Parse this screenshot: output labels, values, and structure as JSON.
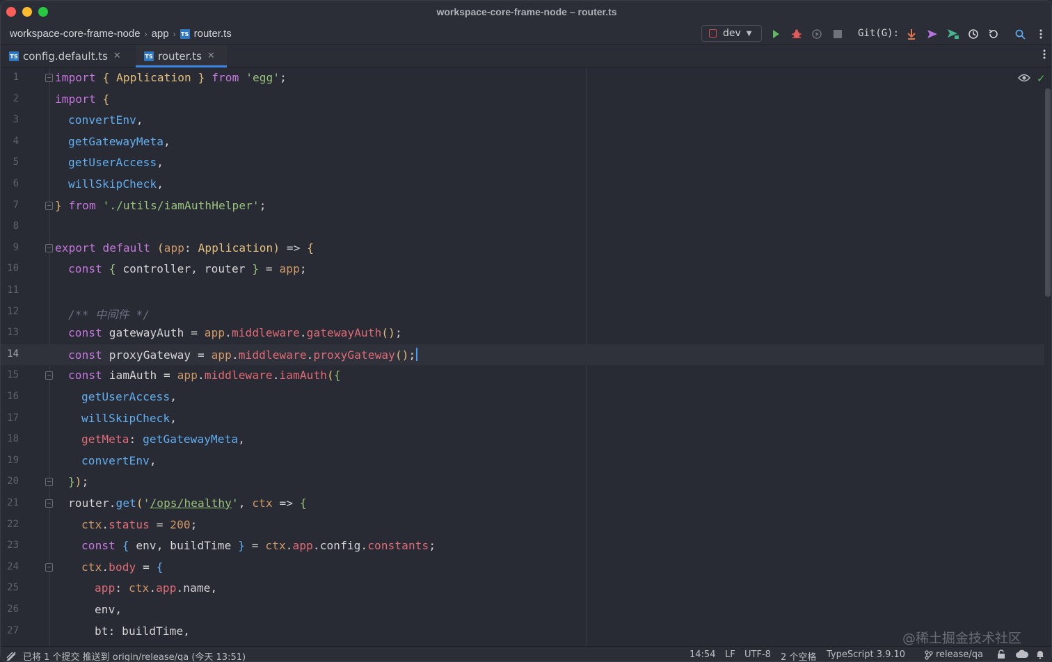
{
  "window": {
    "title": "workspace-core-frame-node – router.ts"
  },
  "breadcrumb": {
    "items": [
      {
        "label": "workspace-core-frame-node"
      },
      {
        "label": "app"
      },
      {
        "label": "router.ts"
      }
    ],
    "separator": "›"
  },
  "toolbar": {
    "run_config": "dev",
    "git_label": "Git(G):"
  },
  "tabs": [
    {
      "label": "config.default.ts",
      "active": false
    },
    {
      "label": "router.ts",
      "active": true
    }
  ],
  "editor": {
    "current_line": 14,
    "line_numbers": [
      "1",
      "2",
      "3",
      "4",
      "5",
      "6",
      "7",
      "8",
      "9",
      "10",
      "11",
      "12",
      "13",
      "14",
      "15",
      "16",
      "17",
      "18",
      "19",
      "20",
      "21",
      "22",
      "23",
      "24",
      "25",
      "26",
      "27"
    ]
  },
  "status": {
    "message": "已将 1 个提交 推送到 origin/release/qa (今天 13:51)",
    "position": "14:54",
    "line_ending": "LF",
    "encoding": "UTF-8",
    "indent": "2 个空格",
    "language": "TypeScript 3.9.10",
    "branch": "release/qa"
  },
  "watermark": "@稀土掘金技术社区",
  "colors": {
    "background": "#282a34",
    "keyword": "#c678dd",
    "function": "#61afef",
    "string": "#98c379",
    "property": "#e06c75",
    "number": "#d19a66",
    "accent": "#3d86e6"
  }
}
